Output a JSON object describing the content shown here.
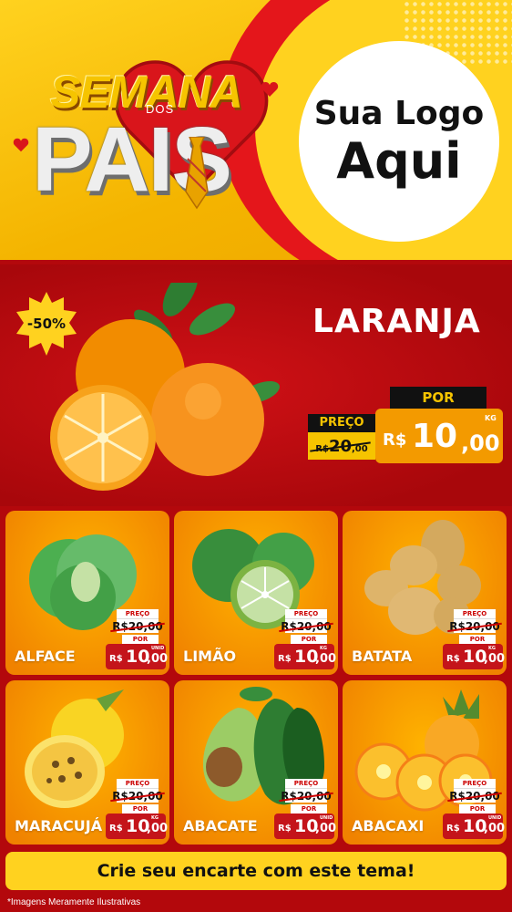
{
  "header": {
    "title_semana": "SEMANA",
    "title_dos": "DOS",
    "title_pais": "PAIS",
    "logo_line1": "Sua Logo",
    "logo_line2": "Aqui"
  },
  "featured": {
    "discount": "-50%",
    "name": "LARANJA",
    "por_label": "POR",
    "preco_label": "PREÇO",
    "old_price_currency": "R$",
    "old_price_value": "20",
    "old_price_cents": ",00",
    "new_price_currency": "R$",
    "new_price_value": "10",
    "new_price_cents": ",00",
    "unit": "KG"
  },
  "products": [
    {
      "name": "ALFACE",
      "unit": "UNID",
      "icon": "lettuce-icon"
    },
    {
      "name": "LIMÃO",
      "unit": "KG",
      "icon": "lime-icon"
    },
    {
      "name": "BATATA",
      "unit": "KG",
      "icon": "potato-icon"
    },
    {
      "name": "MARACUJÁ",
      "unit": "KG",
      "icon": "passion-fruit-icon"
    },
    {
      "name": "ABACATE",
      "unit": "UNID",
      "icon": "avocado-icon"
    },
    {
      "name": "ABACAXI",
      "unit": "UNID",
      "icon": "pineapple-icon"
    }
  ],
  "price_labels": {
    "preco": "PREÇO",
    "old": "R$20,00",
    "por": "POR",
    "currency": "R$",
    "value": "10",
    "cents": ",00"
  },
  "cta": "Crie seu encarte com este tema!",
  "footnote": "*Imagens Meramente Ilustrativas",
  "colors": {
    "yellow": "#ffd21f",
    "red": "#b3080c",
    "orange": "#f39a00",
    "price_red": "#c4141a"
  }
}
